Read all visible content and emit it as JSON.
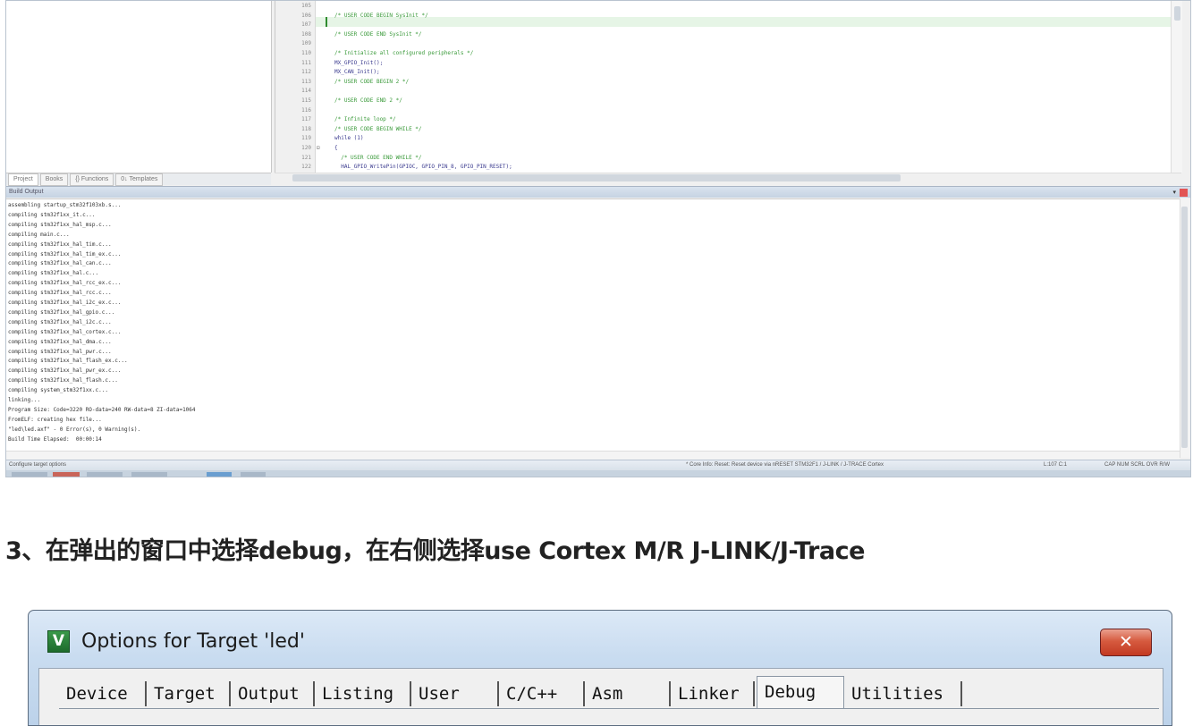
{
  "ide": {
    "project_tabs": [
      "Project",
      "Books",
      "{} Functions",
      "0↓ Templates"
    ],
    "editor": {
      "lines": [
        {
          "n": "105",
          "code": "",
          "kind": "normal"
        },
        {
          "n": "106",
          "code": "/* USER CODE BEGIN SysInit */",
          "kind": "comment"
        },
        {
          "n": "107",
          "code": "",
          "kind": "normal"
        },
        {
          "n": "108",
          "code": "/* USER CODE END SysInit */",
          "kind": "comment"
        },
        {
          "n": "109",
          "code": "",
          "kind": "normal"
        },
        {
          "n": "110",
          "code": "/* Initialize all configured peripherals */",
          "kind": "comment"
        },
        {
          "n": "111",
          "code": "MX_GPIO_Init();",
          "kind": "normal"
        },
        {
          "n": "112",
          "code": "MX_CAN_Init();",
          "kind": "normal"
        },
        {
          "n": "113",
          "code": "/* USER CODE BEGIN 2 */",
          "kind": "comment"
        },
        {
          "n": "114",
          "code": "",
          "kind": "normal"
        },
        {
          "n": "115",
          "code": "/* USER CODE END 2 */",
          "kind": "comment"
        },
        {
          "n": "116",
          "code": "",
          "kind": "normal"
        },
        {
          "n": "117",
          "code": "/* Infinite loop */",
          "kind": "comment"
        },
        {
          "n": "118",
          "code": "/* USER CODE BEGIN WHILE */",
          "kind": "comment"
        },
        {
          "n": "119",
          "code": "while (1)",
          "kind": "normal"
        },
        {
          "n": "120",
          "code": "{",
          "kind": "normal"
        },
        {
          "n": "121",
          "code": "  /* USER CODE END WHILE */",
          "kind": "comment"
        },
        {
          "n": "122",
          "code": "  HAL_GPIO_WritePin(GPIOC, GPIO_PIN_8, GPIO_PIN_RESET);",
          "kind": "normal"
        }
      ]
    },
    "build_output": {
      "title": "Build Output",
      "lines": [
        "assembling startup_stm32f103xb.s...",
        "compiling stm32f1xx_it.c...",
        "compiling stm32f1xx_hal_msp.c...",
        "compiling main.c...",
        "compiling stm32f1xx_hal_tim.c...",
        "compiling stm32f1xx_hal_tim_ex.c...",
        "compiling stm32f1xx_hal_can.c...",
        "compiling stm32f1xx_hal.c...",
        "compiling stm32f1xx_hal_rcc_ex.c...",
        "compiling stm32f1xx_hal_rcc.c...",
        "compiling stm32f1xx_hal_i2c_ex.c...",
        "compiling stm32f1xx_hal_gpio.c...",
        "compiling stm32f1xx_hal_i2c.c...",
        "compiling stm32f1xx_hal_cortex.c...",
        "compiling stm32f1xx_hal_dma.c...",
        "compiling stm32f1xx_hal_pwr.c...",
        "compiling stm32f1xx_hal_flash_ex.c...",
        "compiling stm32f1xx_hal_pwr_ex.c...",
        "compiling stm32f1xx_hal_flash.c...",
        "compiling system_stm32f1xx.c...",
        "linking...",
        "Program Size: Code=3220 RO-data=240 RW-data=8 ZI-data=1064",
        "FromELF: creating hex file...",
        "\"led\\led.axf\" - 0 Error(s), 0 Warning(s).",
        "Build Time Elapsed:  00:00:14"
      ]
    },
    "status": {
      "left": "Configure target options",
      "center": "* Core Info: Reset: Reset device via nRESET STM32F1 / J-LINK / J-TRACE Cortex",
      "pos": "L:107 C:1",
      "right": "CAP NUM SCRL OVR R/W"
    }
  },
  "heading": "3、在弹出的窗口中选择debug，在右侧选择use Cortex M/R J-LINK/J-Trace",
  "dialog": {
    "icon_letter": "V",
    "title": "Options for Target 'led'",
    "close_label": "✕",
    "tabs": [
      "Device",
      "Target",
      "Output",
      "Listing",
      "User",
      "C/C++",
      "Asm",
      "Linker",
      "Debug",
      "Utilities"
    ],
    "selected_tab": "Debug"
  },
  "colors": {
    "comment": "#3a9a3a",
    "code": "#3b3b8f",
    "close_button": "#c23a22",
    "dialog_frame": "#c9dcf0"
  }
}
